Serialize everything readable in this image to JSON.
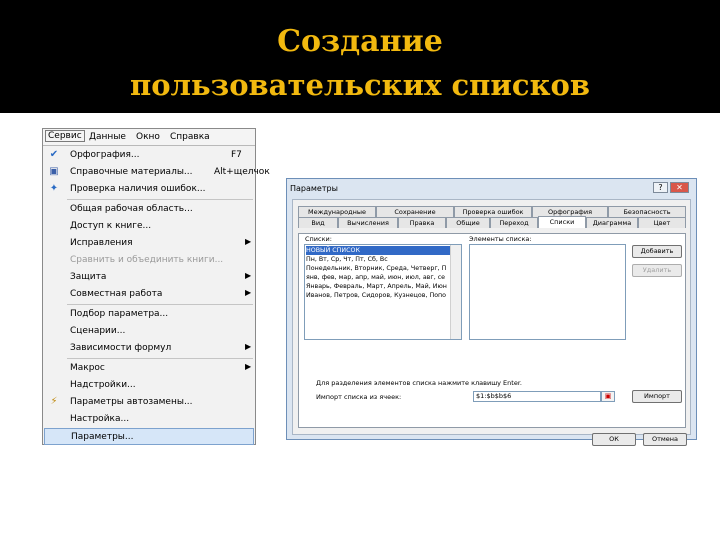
{
  "slide": {
    "title_line1": "Создание",
    "title_line2": "пользовательских списков",
    "title_color": "#f2b90f",
    "banner_color": "#000000"
  },
  "menu": {
    "bar": [
      "Сервис",
      "Данные",
      "Окно",
      "Справка"
    ],
    "items": [
      {
        "label": "Орфография...",
        "shortcut": "F7",
        "icon": "spellcheck-icon"
      },
      {
        "label": "Справочные материалы...",
        "shortcut": "Alt+щелчок",
        "icon": "research-icon"
      },
      {
        "label": "Проверка наличия ошибок...",
        "icon": "error-check-icon"
      },
      {
        "label": "Общая рабочая область..."
      },
      {
        "label": "Доступ к книге..."
      },
      {
        "label": "Исправления"
      },
      {
        "label": "Сравнить и объединить книги..."
      },
      {
        "label": "Защита"
      },
      {
        "label": "Совместная работа"
      },
      {
        "label": "Подбор параметра..."
      },
      {
        "label": "Сценарии..."
      },
      {
        "label": "Зависимости формул"
      },
      {
        "label": "Макрос"
      },
      {
        "label": "Надстройки..."
      },
      {
        "label": "Параметры автозамены...",
        "icon": "autocorrect-icon"
      },
      {
        "label": "Настройка..."
      },
      {
        "label": "Параметры..."
      }
    ]
  },
  "dialog": {
    "title": "Параметры",
    "help_btn": "?",
    "close_btn": "✕",
    "tabs_row1": [
      "Международные",
      "Сохранение",
      "Проверка ошибок",
      "Орфография",
      "Безопасность"
    ],
    "tabs_row2": [
      "Вид",
      "Вычисления",
      "Правка",
      "Общие",
      "Переход",
      "Списки",
      "Диаграмма",
      "Цвет"
    ],
    "lists_label": "Списки:",
    "elements_label": "Элементы списка:",
    "lists": [
      "НОВЫЙ СПИСОК",
      "Пн, Вт, Ср, Чт, Пт, Сб, Вс",
      "Понедельник, Вторник, Среда, Четверг, П",
      "янв, фев, мар, апр, май, июн, июл, авг, се",
      "Январь, Февраль, Март, Апрель, Май, Июн",
      "Иванов, Петров, Сидоров, Кузнецов, Попо"
    ],
    "add_btn": "Добавить",
    "delete_btn": "Удалить",
    "hint": "Для разделения элементов списка нажмите клавишу Enter.",
    "import_label": "Импорт списка из ячеек:",
    "import_value": "$1:$b$b$6",
    "import_btn": "Импорт",
    "ok_btn": "ОК",
    "cancel_btn": "Отмена"
  }
}
